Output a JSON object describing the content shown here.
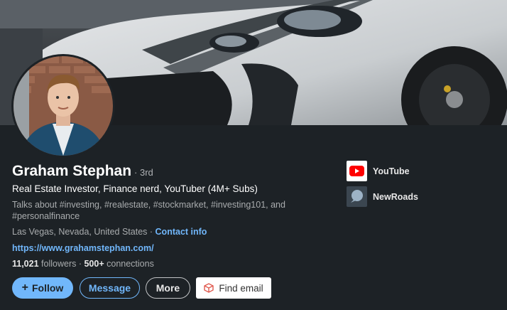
{
  "profile": {
    "name": "Graham Stephan",
    "degree": "· 3rd",
    "headline": "Real Estate Investor, Finance nerd, YouTuber (4M+ Subs)",
    "hashtags": "Talks about #investing, #realestate, #stockmarket, #investing101, and #personalfinance",
    "location": "Las Vegas, Nevada, United States ·",
    "contact_label": "Contact info",
    "website": "https://www.grahamstephan.com/",
    "followers_count": "11,021",
    "followers_label": "followers ·",
    "connections_count": "500+",
    "connections_label": "connections"
  },
  "actions": {
    "follow_label": "Follow",
    "message_label": "Message",
    "more_label": "More",
    "find_email_label": "Find email"
  },
  "side": {
    "items": [
      {
        "label": "YouTube",
        "icon": "youtube-logo"
      },
      {
        "label": "NewRoads",
        "icon": "newroads-logo"
      }
    ]
  },
  "colors": {
    "background": "#1d2226",
    "accent": "#71b7fb",
    "youtube_red": "#ff0000"
  }
}
